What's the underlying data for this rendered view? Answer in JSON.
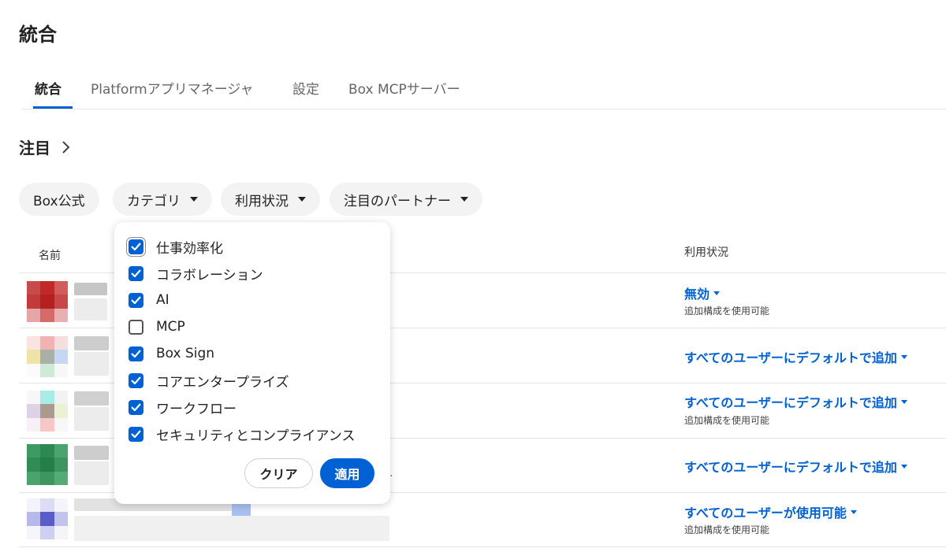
{
  "page": {
    "title": "統合"
  },
  "tabs": [
    {
      "label": "統合"
    },
    {
      "label": "Platformアプリマネージャ"
    },
    {
      "label": "設定"
    },
    {
      "label": "Box MCPサーバー"
    }
  ],
  "section": {
    "title": "注目",
    "chevron_icon": "chevron-right-icon"
  },
  "filters": {
    "box_official": "Box公式",
    "category": "カテゴリ",
    "usage": "利用状況",
    "partner": "注目のパートナー"
  },
  "table": {
    "headers": {
      "name": "名前",
      "status": "利用状況"
    },
    "rows": [
      {
        "status": "無効",
        "sub": "追加構成を使用可能",
        "trunc": ""
      },
      {
        "status": "すべてのユーザーにデフォルトで追加",
        "sub": "",
        "trunc": "."
      },
      {
        "status": "すべてのユーザーにデフォルトで追加",
        "sub": "追加構成を使用可能",
        "trunc": ""
      },
      {
        "status": "すべてのユーザーにデフォルトで追加",
        "sub": "",
        "trunc": ".."
      },
      {
        "status": "すべてのユーザーが使用可能",
        "sub": "追加構成を使用可能",
        "trunc": ""
      }
    ]
  },
  "category_dropdown": {
    "options": [
      {
        "label": "仕事効率化",
        "checked": true
      },
      {
        "label": "コラボレーション",
        "checked": true
      },
      {
        "label": "AI",
        "checked": true
      },
      {
        "label": "MCP",
        "checked": false
      },
      {
        "label": "Box Sign",
        "checked": true
      },
      {
        "label": "コアエンタープライズ",
        "checked": true
      },
      {
        "label": "ワークフロー",
        "checked": true
      },
      {
        "label": "セキュリティとコンプライアンス",
        "checked": true
      }
    ],
    "clear_label": "クリア",
    "apply_label": "適用"
  },
  "colors": {
    "accent": "#0061d5"
  }
}
